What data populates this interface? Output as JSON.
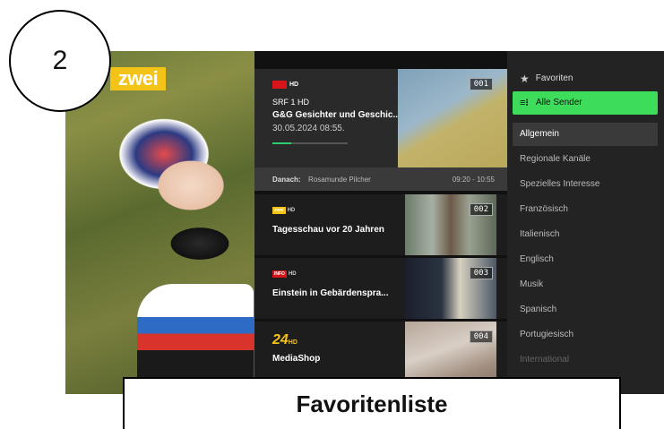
{
  "step": {
    "number": "2"
  },
  "caption": "Favoritenliste",
  "video": {
    "channel_logo": "zwei"
  },
  "current": {
    "logo_text": "HD",
    "channel": "SRF 1 HD",
    "title": "G&G Gesichter und Geschic...",
    "date": "30.05.2024 08:55.",
    "number": "001",
    "progress": 0.25
  },
  "next": {
    "label": "Danach:",
    "program": "Rosamunde Pilcher",
    "time": "09:20 - 10:55"
  },
  "channels": [
    {
      "logo": "zwei",
      "logo_hd": "HD",
      "title": "Tagesschau vor 20 Jahren",
      "number": "002"
    },
    {
      "logo": "INFO",
      "logo_hd": "HD",
      "title": "Einstein in Gebärdenspra...",
      "number": "003"
    },
    {
      "logo": "24",
      "logo_hd": "HD",
      "title": "MediaShop",
      "number": "004"
    }
  ],
  "menu": {
    "favorites": "Favoriten",
    "all": "Alle Sender",
    "categories": [
      "Allgemein",
      "Regionale Kanäle",
      "Spezielles Interesse",
      "Französisch",
      "Italienisch",
      "Englisch",
      "Musik",
      "Spanisch",
      "Portugiesisch",
      "International"
    ]
  },
  "colors": {
    "accent": "#3ddc5b",
    "brand_yellow": "#f4c318",
    "srf_red": "#d7141a"
  }
}
